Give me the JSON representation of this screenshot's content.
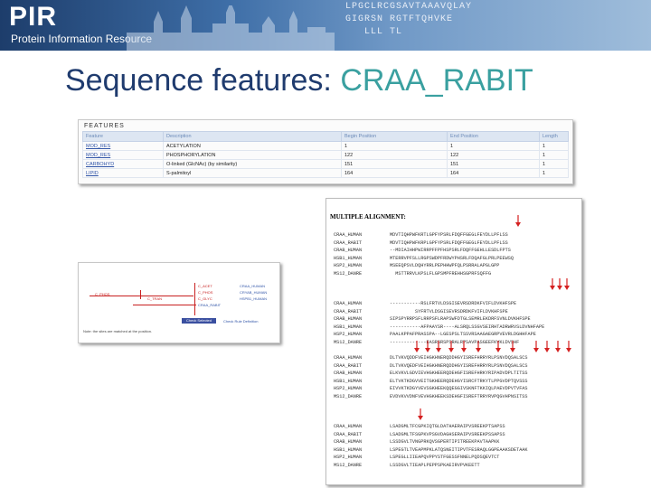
{
  "banner": {
    "logo": "PIR",
    "subtitle": "Protein Information Resource",
    "seq_lines": [
      "LPGCLRCGSAVTAAAVQLAY",
      "GIGRSN RGTFTQHVKE",
      "   LLL TL"
    ],
    "color_dark": "#1d3d6b",
    "color_light": "#9fbddb"
  },
  "slide": {
    "title_prefix": "Sequence features: ",
    "title_highlight": "CRAA_RABIT",
    "title_color": "#1f3b6e",
    "highlight_color": "#3aa0a0"
  },
  "features": {
    "heading": "FEATURES",
    "columns": [
      "Feature",
      "Description",
      "Begin Position",
      "End Position",
      "Length"
    ],
    "rows": [
      [
        "MOD_RES",
        "ACETYLATION",
        "1",
        "1",
        "1"
      ],
      [
        "MOD_RES",
        "PHOSPHORYLATION",
        "122",
        "122",
        "1"
      ],
      [
        "CARBOHYD",
        "O-linked (GlcNAc) (by similarity)",
        "151",
        "151",
        "1"
      ],
      [
        "LIPID",
        "S-palmitoyl",
        "164",
        "164",
        "1"
      ]
    ]
  },
  "small_panel": {
    "labels": [
      "C_PHOS",
      "C_TRAN",
      "C_ACET",
      "C_PHOS",
      "C_GLYC",
      "CRAA_RABIT",
      "CRAA_HUMAN",
      "CRYAB_HUMAN",
      "HSPB1_HUMAN"
    ],
    "button": "Check Selected Rules",
    "button_right": "Check Rule Definition",
    "footnote": "Note: the sites are matched at the position."
  },
  "alignment": {
    "title": "MULTIPLE ALIGNMENT:",
    "blocks": [
      [
        [
          "CRAA_HUMAN",
          "MDVTIQHPWFKRTLGPFYPSRLFDQFFGEGLFEYDLLPFLSS"
        ],
        [
          "CRAA_RABIT",
          "MDVTIQHPWFKRPLGPFYPSRLFDQFFGEGLFEYDLLPFLSS"
        ],
        [
          "CRAB_HUMAN",
          "--MDIAIHHPWIRRPFFPFHSPSRLFDQFFGEHLLESDLFPTS"
        ],
        [
          "HSB1_HUMAN",
          "MTERRVPFSLLRGPSWDPFRDWYPHSRLFDQAFGLPRLPEEWSQ"
        ],
        [
          "HSP2_HUMAN",
          "MSEEQPSVLDQHYRRLPEPHHWPFQLPSRRALAPGLGPP"
        ],
        [
          "MS12_DANRE",
          "  MSTTRRVLKPSLFLGPSMPFREHHSGPRFSQFFG"
        ]
      ],
      [
        [
          "CRAA_HUMAN",
          "-----------RSLFRTVLDSGISEVRSDRDKFVIFLDVKHFSPE"
        ],
        [
          "CRAA_RABIT",
          "         SYFRTVLDSGISEVRSDRDKFVIFLDVKHFSPE"
        ],
        [
          "CRAB_HUMAN",
          "SIPSPYRRPSFLRRPSFLRAPSWFDTGLSEMRLEKDRFSVNLDVKHFSPE"
        ],
        [
          "HSB1_HUMAN",
          "-----------AFPAAYSR----ALSRQLSSGVSEIRHTADRWRVSLDVNHFAPE"
        ],
        [
          "HSP2_HUMAN",
          "PAALKPPAFPRASSPA--LGESPSLTSSVRSAAGAEGRPVEVRLDGHHFAPE"
        ],
        [
          "MS12_DANRE",
          "-------------EASRSRSPSRALRPSAVPASGEEFKVKLDVSHF"
        ]
      ],
      [
        [
          "CRAA_HUMAN",
          "DLTVKVQDDFVEIHGKHNERQDDHGYISREFHRRYRLPSNVDQSALSCS"
        ],
        [
          "CRAA_RABIT",
          "DLTVKVQEDFVEIHGKHNERQDDHGYISREFHRRYRLPSNVDQSALSCS"
        ],
        [
          "CRAB_HUMAN",
          "ELKVKVLGDVIEVHGKHEERQDEHGFISREFHRKYRIPADVDPLTITSS"
        ],
        [
          "HSB1_HUMAN",
          "ELTVKTKDGVVEITGKHEERQDEHGYISRCFTRKYTLPPGVDPTQVSSS"
        ],
        [
          "HSP2_HUMAN",
          "EIVVKTKDGYVEVSGKHEEKQQEGGIVSKNFTKKIQLPAEVDPVTVFAS"
        ],
        [
          "MS12_DANRE",
          "EVDVKVVDNFVEVHGKHEEKSDEHGFISREFTRRYRVPQGVHPNSITSS"
        ]
      ],
      [
        [
          "CRAA_HUMAN",
          "LSADGMLTFCGPKIQTGLDATHAERAIPVSREEKPTSAPSS"
        ],
        [
          "CRAA_RABIT",
          "LSADGMLTFSGPKVPSGVDAGHSERAIPVSREEKPSSAPSS"
        ],
        [
          "CRAB_HUMAN",
          "LSSDGVLTVNGPRKQVSGPERTIPITREEKPAVTAAPKK"
        ],
        [
          "HSB1_HUMAN",
          "LSPEGTLTVEAPMPKLATQSNEITIPVTFESRAQLGGPEAAKSDETAAK"
        ],
        [
          "HSP2_HUMAN",
          "LSPEGLLIIEAPQVPPYSTFGESSFNNELPQDSQEVTCT"
        ],
        [
          "MS12_DANRE",
          "LSSDGVLTIEAPLPEPPSPKAEIRVPVKEETT"
        ]
      ]
    ],
    "marker_color": "#d42020"
  }
}
